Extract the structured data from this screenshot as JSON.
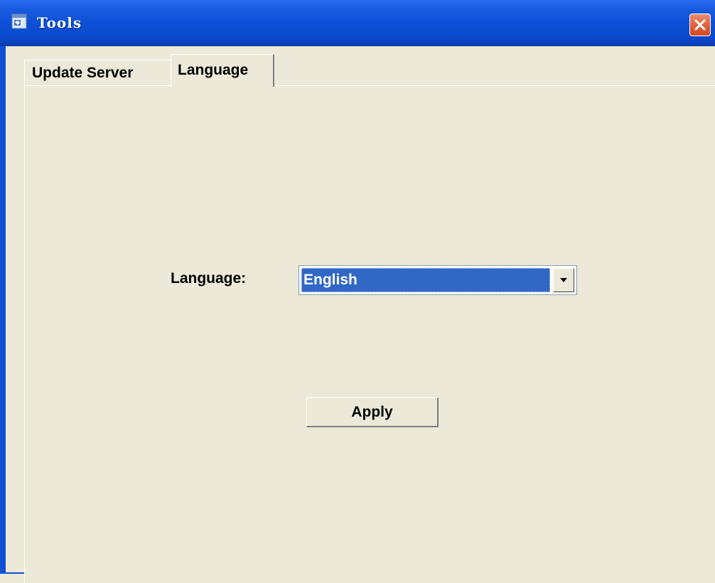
{
  "window": {
    "title": "Tools",
    "title_color": "#ffffff",
    "titlebar_color": "#0c4fd6",
    "close_color": "#e3653f"
  },
  "tabs": [
    {
      "label": "Update Server",
      "selected": false
    },
    {
      "label": "Language",
      "selected": true
    }
  ],
  "language_tab": {
    "language_label": "Language:",
    "language_select": {
      "selected_value": "English",
      "highlight_color": "#3168c6"
    },
    "apply_label": "Apply"
  },
  "icons": {
    "app": "app-window-icon",
    "close": "close-icon",
    "dropdown": "chevron-down-icon"
  },
  "colors": {
    "background": "#ece9d8"
  }
}
